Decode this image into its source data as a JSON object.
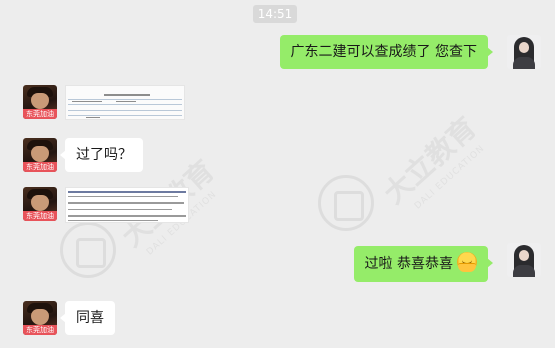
{
  "time_label": "14:51",
  "avatar_left_tag": "东莞加油",
  "watermark": {
    "name": "大立教育",
    "sub": "DALI EDUCATION"
  },
  "messages": [
    {
      "side": "right",
      "type": "text",
      "text": "广东二建可以查成绩了  您查下"
    },
    {
      "side": "left",
      "type": "image",
      "alt": "成绩截图"
    },
    {
      "side": "left",
      "type": "text",
      "text": "过了吗？"
    },
    {
      "side": "left",
      "type": "image",
      "alt": "文字截图"
    },
    {
      "side": "right",
      "type": "text",
      "text": "过啦  恭喜恭喜",
      "emoji": "hugging-face"
    },
    {
      "side": "left",
      "type": "text",
      "text": "同喜"
    }
  ],
  "colors": {
    "bg": "#ededed",
    "sent_bubble": "#95ec69",
    "recv_bubble": "#ffffff",
    "time_chip": "#d9d9d9"
  }
}
